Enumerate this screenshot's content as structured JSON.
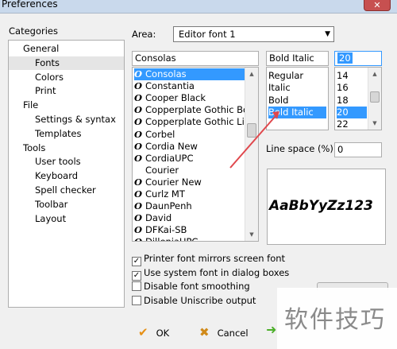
{
  "window": {
    "title": "Preferences",
    "close_glyph": "✕"
  },
  "categories": {
    "label": "Categories",
    "items": [
      {
        "label": "General",
        "level": 1
      },
      {
        "label": "Fonts",
        "level": 2,
        "selected": true
      },
      {
        "label": "Colors",
        "level": 2
      },
      {
        "label": "Print",
        "level": 2
      },
      {
        "label": "File",
        "level": 1
      },
      {
        "label": "Settings & syntax",
        "level": 2
      },
      {
        "label": "Templates",
        "level": 2
      },
      {
        "label": "Tools",
        "level": 1
      },
      {
        "label": "User tools",
        "level": 2
      },
      {
        "label": "Keyboard",
        "level": 2
      },
      {
        "label": "Spell checker",
        "level": 2
      },
      {
        "label": "Toolbar",
        "level": 2
      },
      {
        "label": "Layout",
        "level": 2
      }
    ]
  },
  "area": {
    "label": "Area:",
    "value": "Editor font 1"
  },
  "font_name": {
    "value": "Consolas",
    "items": [
      {
        "label": "Consolas",
        "selected": true,
        "icon": true
      },
      {
        "label": "Constantia",
        "icon": true
      },
      {
        "label": "Cooper Black",
        "icon": true
      },
      {
        "label": "Copperplate Gothic Bold",
        "icon": true
      },
      {
        "label": "Copperplate Gothic Light",
        "icon": true
      },
      {
        "label": "Corbel",
        "icon": true
      },
      {
        "label": "Cordia New",
        "icon": true
      },
      {
        "label": "CordiaUPC",
        "icon": true
      },
      {
        "label": "Courier",
        "icon": false
      },
      {
        "label": "Courier New",
        "icon": true
      },
      {
        "label": "Curlz MT",
        "icon": true
      },
      {
        "label": "DaunPenh",
        "icon": true
      },
      {
        "label": "David",
        "icon": true
      },
      {
        "label": "DFKai-SB",
        "icon": true
      },
      {
        "label": "DilleniaUPC",
        "icon": true
      }
    ]
  },
  "font_style": {
    "value": "Bold Italic",
    "items": [
      {
        "label": "Regular"
      },
      {
        "label": "Italic"
      },
      {
        "label": "Bold"
      },
      {
        "label": "Bold Italic",
        "selected": true
      }
    ]
  },
  "font_size": {
    "value": "20",
    "items": [
      {
        "label": "14"
      },
      {
        "label": "16"
      },
      {
        "label": "18"
      },
      {
        "label": "20",
        "selected": true
      },
      {
        "label": "22"
      }
    ]
  },
  "line_space": {
    "label": "Line space (%):",
    "value": "0"
  },
  "preview": {
    "text": "AaBbYyZz123"
  },
  "options": [
    {
      "label": "Printer font mirrors screen font",
      "checked": true
    },
    {
      "label": "Use system font in dialog boxes",
      "checked": true
    },
    {
      "label": "Disable font smoothing",
      "checked": false
    },
    {
      "label": "Disable Uniscribe output",
      "checked": false
    }
  ],
  "buttons": {
    "ok": "OK",
    "cancel": "Cancel"
  },
  "watermark": "软件技巧",
  "colors": {
    "selection": "#3399ff",
    "annotation_arrow": "#e0474c"
  }
}
